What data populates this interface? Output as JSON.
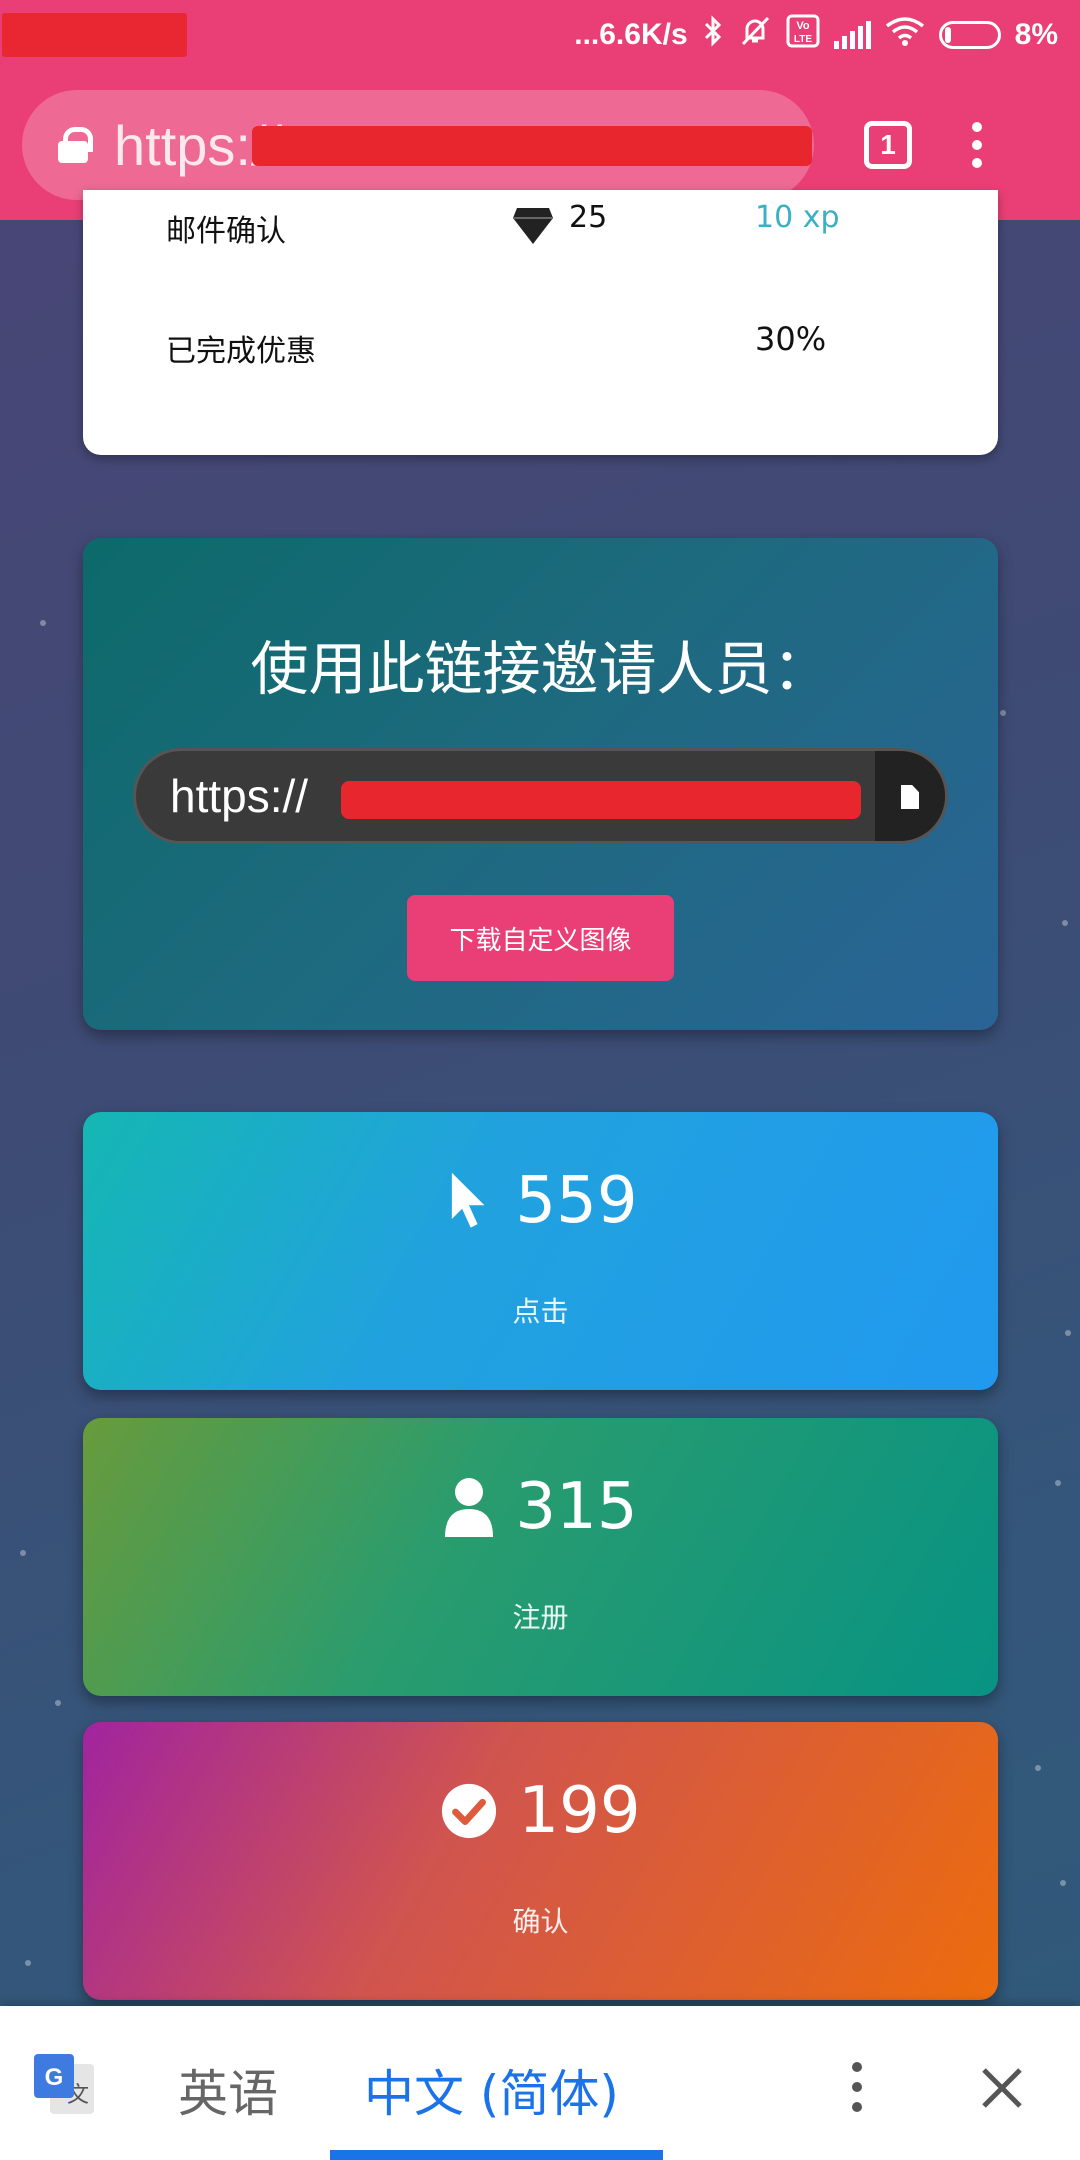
{
  "status_bar": {
    "net_speed": "...6.6K/s",
    "battery": "8%",
    "volte_label": "Vo LTE"
  },
  "browser": {
    "url_prefix": "https://",
    "tab_count": "1"
  },
  "summary_card": {
    "row1_label": "邮件确认",
    "row1_gems": "25",
    "row1_xp": "10 xp",
    "row2_label": "已完成优惠",
    "row2_value": "30%"
  },
  "invite": {
    "title": "使用此链接邀请人员：",
    "link_prefix": "https://",
    "download_button": "下载自定义图像"
  },
  "stats": [
    {
      "value": "559",
      "label": "点击",
      "icon": "cursor-icon"
    },
    {
      "value": "315",
      "label": "注册",
      "icon": "user-icon"
    },
    {
      "value": "199",
      "label": "确认",
      "icon": "check-circle-icon"
    }
  ],
  "translate_bar": {
    "source_lang": "英语",
    "target_lang": "中文 (简体)"
  },
  "colors": {
    "accent": "#ea3f76",
    "link_blue": "#1a73e8"
  }
}
